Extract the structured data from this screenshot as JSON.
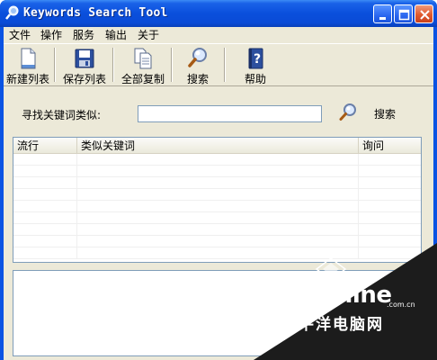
{
  "window": {
    "title": "Keywords Search Tool",
    "accent": "#0a53e3"
  },
  "menu": [
    "文件",
    "操作",
    "服务",
    "输出",
    "关于"
  ],
  "toolbar": [
    {
      "label": "新建列表",
      "icon": "new-list-icon"
    },
    {
      "label": "保存列表",
      "icon": "save-disk-icon"
    },
    {
      "label": "全部复制",
      "icon": "copy-all-icon"
    },
    {
      "label": "搜索",
      "icon": "magnifier-icon"
    },
    {
      "label": "帮助",
      "icon": "help-book-icon"
    }
  ],
  "search": {
    "label": "寻找关键词类似:",
    "value": "",
    "button_label": "搜索"
  },
  "table": {
    "columns": [
      "流行",
      "类似关键词",
      "询问"
    ],
    "rows": []
  },
  "watermark": {
    "brand": "PConline",
    "domain": ".com.cn",
    "chinese": "太平洋电脑网"
  }
}
